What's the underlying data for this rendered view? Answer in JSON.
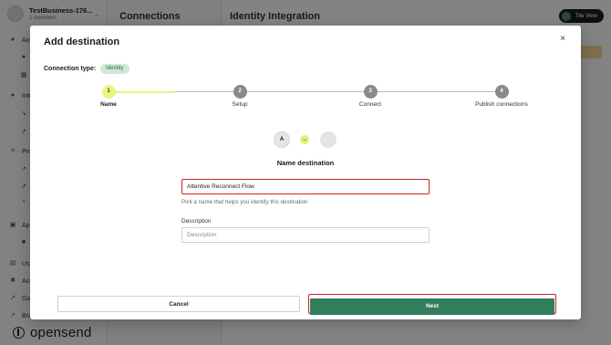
{
  "workspace": {
    "name": "TestBusiness-176...",
    "members": "1 members"
  },
  "sidebar": {
    "items": [
      {
        "label": "Au",
        "icon": "user-icon"
      },
      {
        "label": "",
        "icon": "user-icon"
      },
      {
        "label": "",
        "icon": "grid-icon"
      },
      {
        "label": "Inte",
        "icon": "dot-icon"
      },
      {
        "label": "",
        "icon": "link-icon"
      },
      {
        "label": "",
        "icon": "link-icon"
      },
      {
        "label": "Pro",
        "icon": "layers-icon"
      },
      {
        "label": "",
        "icon": "link-icon"
      },
      {
        "label": "",
        "icon": "link-icon"
      },
      {
        "label": "",
        "icon": "chevron-icon"
      },
      {
        "label": "App",
        "icon": "apps-icon"
      },
      {
        "label": "",
        "icon": "tag-icon"
      },
      {
        "label": "Usa",
        "icon": "chart-icon"
      },
      {
        "label": "Acc",
        "icon": "gear-icon"
      },
      {
        "label": "Go",
        "icon": "link-icon"
      },
      {
        "label": "Bra",
        "icon": "link-icon"
      }
    ]
  },
  "brand": {
    "name": "opensend"
  },
  "column2": {
    "title": "Connections"
  },
  "main": {
    "title": "Identity Integration",
    "tile_view_label": "Tile View"
  },
  "modal": {
    "title": "Add destination",
    "close_glyph": "×",
    "connection_type_label": "Connection type:",
    "connection_type_value": "Identity",
    "steps": [
      {
        "number": "1",
        "label": "Name"
      },
      {
        "number": "2",
        "label": "Setup"
      },
      {
        "number": "3",
        "label": "Connect"
      },
      {
        "number": "4",
        "label": "Publish connections"
      }
    ],
    "active_step": 1,
    "flow": {
      "source_glyph": "A",
      "arrow_glyph": "→"
    },
    "section_title": "Name destination",
    "name_field": {
      "value": "Attentive Reconnect Flow",
      "hint": "Pick a name that helps you identify this destination"
    },
    "description_field": {
      "label": "Description",
      "placeholder": "Description",
      "value": ""
    },
    "cancel_label": "Cancel",
    "next_label": "Next"
  },
  "colors": {
    "primary": "#2f7f5c",
    "accent": "#e9f57f",
    "badge_bg": "#cfe9d7",
    "highlight": "#d32020"
  }
}
